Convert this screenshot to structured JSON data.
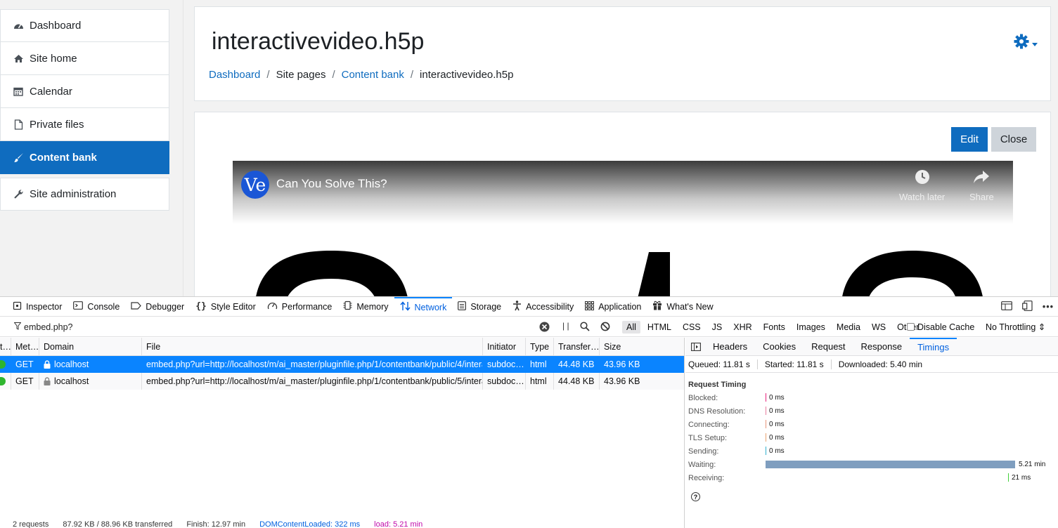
{
  "nav": {
    "items": [
      {
        "label": "Dashboard",
        "icon": "dashboard-icon"
      },
      {
        "label": "Site home",
        "icon": "home-icon"
      },
      {
        "label": "Calendar",
        "icon": "calendar-icon"
      },
      {
        "label": "Private files",
        "icon": "file-icon"
      },
      {
        "label": "Content bank",
        "icon": "paintbrush-icon",
        "active": true
      },
      {
        "label": "Site administration",
        "icon": "wrench-icon"
      }
    ]
  },
  "header": {
    "title": "interactivevideo.h5p",
    "breadcrumb": [
      "Dashboard",
      "Site pages",
      "Content bank",
      "interactivevideo.h5p"
    ]
  },
  "content": {
    "edit_label": "Edit",
    "close_label": "Close",
    "video": {
      "channel_initials": "Ve",
      "title": "Can You Solve This?",
      "watch_later": "Watch later",
      "share": "Share"
    }
  },
  "devtools": {
    "tabs": [
      "Inspector",
      "Console",
      "Debugger",
      "Style Editor",
      "Performance",
      "Memory",
      "Network",
      "Storage",
      "Accessibility",
      "Application",
      "What's New"
    ],
    "active_tab": "Network",
    "filter_value": "embed.php?",
    "type_filters": [
      "All",
      "HTML",
      "CSS",
      "JS",
      "XHR",
      "Fonts",
      "Images",
      "Media",
      "WS",
      "Other"
    ],
    "disable_cache": "Disable Cache",
    "throttling": "No Throttling ⇕",
    "columns": [
      "t…",
      "Met…",
      "Domain",
      "File",
      "Initiator",
      "Type",
      "Transfer…",
      "Size"
    ],
    "rows": [
      {
        "status": "",
        "method": "GET",
        "domain": "localhost",
        "file": "embed.php?url=http://localhost/m/ai_master/pluginfile.php/1/contentbank/public/4/intera…",
        "initiator": "subdoc…",
        "type": "html",
        "transferred": "44.48 KB",
        "size": "43.96 KB"
      },
      {
        "status": "",
        "method": "GET",
        "domain": "localhost",
        "file": "embed.php?url=http://localhost/m/ai_master/pluginfile.php/1/contentbank/public/5/intera…",
        "initiator": "subdoc…",
        "type": "html",
        "transferred": "44.48 KB",
        "size": "43.96 KB"
      }
    ],
    "status_bar": {
      "requests": "2 requests",
      "transferred": "87.92 KB / 88.96 KB transferred",
      "finish": "Finish: 12.97 min",
      "dom_loaded": "DOMContentLoaded: 322 ms",
      "load": "load: 5.21 min"
    },
    "details": {
      "tabs": [
        "Headers",
        "Cookies",
        "Request",
        "Response",
        "Timings"
      ],
      "active_tab": "Timings",
      "queued": "Queued: 11.81 s",
      "started": "Started: 11.81 s",
      "downloaded": "Downloaded: 5.40 min",
      "section_title": "Request Timing",
      "timings": [
        {
          "label": "Blocked:",
          "value": "0 ms",
          "color": "#e81f7b"
        },
        {
          "label": "DNS Resolution:",
          "value": "0 ms",
          "color": "#e97c9e"
        },
        {
          "label": "Connecting:",
          "value": "0 ms",
          "color": "#e9967a"
        },
        {
          "label": "TLS Setup:",
          "value": "0 ms",
          "color": "#e9a16e"
        },
        {
          "label": "Sending:",
          "value": "0 ms",
          "color": "#33b1ce"
        },
        {
          "label": "Waiting:",
          "value": "5.21 min",
          "color": "#7f9ebf",
          "fraction": 0.94
        },
        {
          "label": "Receiving:",
          "value": "21 ms",
          "color": "#43d13a"
        }
      ]
    }
  }
}
